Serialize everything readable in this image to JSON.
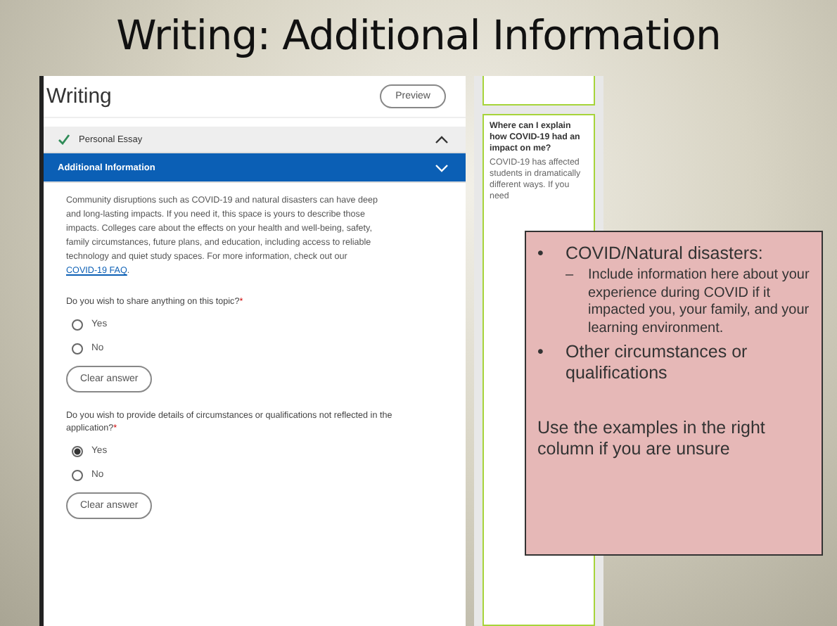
{
  "slide_title": "Writing: Additional Information",
  "screenshot": {
    "heading": "Writing",
    "preview_button": "Preview",
    "sections": [
      {
        "title": "Personal Essay",
        "completed": true,
        "expanded": false
      },
      {
        "title": "Additional Information",
        "completed": false,
        "expanded": true
      }
    ],
    "description": {
      "text": "Community disruptions such as COVID-19 and natural disasters can have deep and long-lasting impacts. If you need it, this space is yours to describe those impacts. Colleges care about the effects on your health and well-being, safety, family circumstances, future plans, and education, including access to reliable technology and quiet study spaces. For more information, check out our ",
      "link": "COVID-19 FAQ",
      "after": "."
    },
    "questions": [
      {
        "prompt": "Do you wish to share anything on this topic?",
        "required_mark": "*",
        "options": [
          {
            "label": "Yes",
            "selected": false
          },
          {
            "label": "No",
            "selected": false
          }
        ],
        "clear_button": "Clear answer"
      },
      {
        "prompt": "Do you wish to provide details of circumstances or qualifications not reflected in the application?",
        "required_mark": "*",
        "options": [
          {
            "label": "Yes",
            "selected": true
          },
          {
            "label": "No",
            "selected": false
          }
        ],
        "clear_button": "Clear answer"
      }
    ]
  },
  "side_column": {
    "question": "Where can I explain how COVID-19 had an impact on me?",
    "answer": "COVID-19 has affected students in dramatically different ways. If you need"
  },
  "callout": {
    "bullets": [
      {
        "marker": "•",
        "text": "COVID/Natural disasters:",
        "children": [
          {
            "marker": "–",
            "text": "Include information here about your experience during COVID if it impacted you, your family, and your learning environment."
          }
        ]
      },
      {
        "marker": "•",
        "text": "Other circumstances or qualifications"
      }
    ],
    "note": "Use the examples in the right column if you are unsure"
  }
}
